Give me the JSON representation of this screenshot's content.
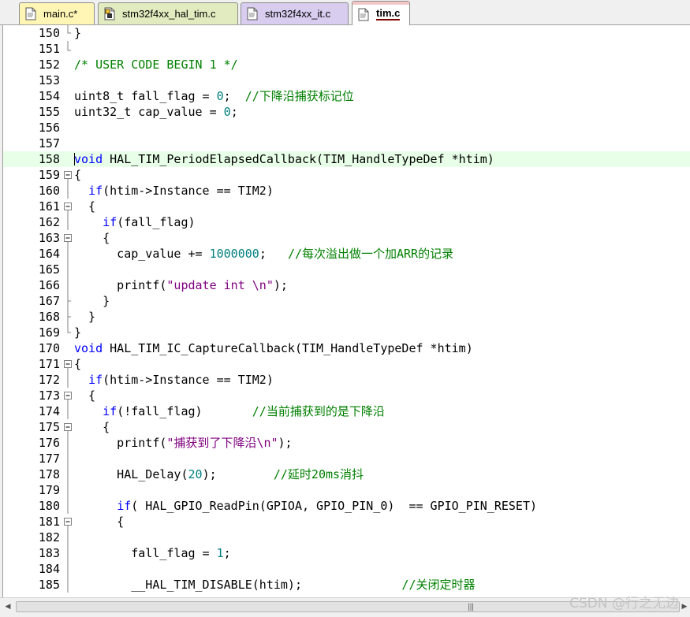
{
  "tabs": [
    {
      "label": "main.c*",
      "icon": "c-file-icon"
    },
    {
      "label": "stm32f4xx_hal_tim.c",
      "icon": "locked-file-icon"
    },
    {
      "label": "stm32f4xx_it.c",
      "icon": "c-file-icon"
    },
    {
      "label": "tim.c",
      "icon": "c-file-icon",
      "active": true
    }
  ],
  "colors": {
    "keyword": "#0000ff",
    "comment": "#008000",
    "number": "#008080",
    "string": "#800080",
    "current_line": "#e8ffe8"
  },
  "lines": [
    {
      "n": "150",
      "fold": "end",
      "tokens": [
        [
          "p",
          "}"
        ]
      ]
    },
    {
      "n": "151",
      "fold": "corner",
      "tokens": []
    },
    {
      "n": "152",
      "fold": "",
      "tokens": [
        [
          "c",
          "/* USER CODE BEGIN 1 */"
        ]
      ]
    },
    {
      "n": "153",
      "fold": "",
      "tokens": []
    },
    {
      "n": "154",
      "fold": "",
      "tokens": [
        [
          "p",
          "uint8_t fall_flag = "
        ],
        [
          "n",
          "0"
        ],
        [
          "p",
          ";  "
        ],
        [
          "c",
          "//下降沿捕获标记位"
        ]
      ]
    },
    {
      "n": "155",
      "fold": "",
      "tokens": [
        [
          "p",
          "uint32_t cap_value = "
        ],
        [
          "n",
          "0"
        ],
        [
          "p",
          ";"
        ]
      ]
    },
    {
      "n": "156",
      "fold": "",
      "tokens": []
    },
    {
      "n": "157",
      "fold": "",
      "tokens": []
    },
    {
      "n": "158",
      "fold": "",
      "hl": true,
      "tokens": [
        [
          "k",
          "void"
        ],
        [
          "p",
          " HAL_TIM_PeriodElapsedCallback(TIM_HandleTypeDef *htim)"
        ]
      ]
    },
    {
      "n": "159",
      "fold": "box",
      "tokens": [
        [
          "p",
          "{"
        ]
      ]
    },
    {
      "n": "160",
      "fold": "line",
      "tokens": [
        [
          "p",
          "  "
        ],
        [
          "k",
          "if"
        ],
        [
          "p",
          "(htim->Instance == TIM2)"
        ]
      ]
    },
    {
      "n": "161",
      "fold": "box",
      "tokens": [
        [
          "p",
          "  {"
        ]
      ]
    },
    {
      "n": "162",
      "fold": "line",
      "tokens": [
        [
          "p",
          "    "
        ],
        [
          "k",
          "if"
        ],
        [
          "p",
          "(fall_flag)"
        ]
      ]
    },
    {
      "n": "163",
      "fold": "box",
      "tokens": [
        [
          "p",
          "    {"
        ]
      ]
    },
    {
      "n": "164",
      "fold": "line",
      "tokens": [
        [
          "p",
          "      cap_value += "
        ],
        [
          "n",
          "1000000"
        ],
        [
          "p",
          ";   "
        ],
        [
          "c",
          "//每次溢出做一个加ARR的记录"
        ]
      ]
    },
    {
      "n": "165",
      "fold": "line",
      "tokens": []
    },
    {
      "n": "166",
      "fold": "line",
      "tokens": [
        [
          "p",
          "      printf("
        ],
        [
          "s",
          "\"update int \\n\""
        ],
        [
          "p",
          ");"
        ]
      ]
    },
    {
      "n": "167",
      "fold": "tick",
      "tokens": [
        [
          "p",
          "    }"
        ]
      ]
    },
    {
      "n": "168",
      "fold": "tick",
      "tokens": [
        [
          "p",
          "  }"
        ]
      ]
    },
    {
      "n": "169",
      "fold": "end",
      "tokens": [
        [
          "p",
          "}"
        ]
      ]
    },
    {
      "n": "170",
      "fold": "",
      "tokens": [
        [
          "k",
          "void"
        ],
        [
          "p",
          " HAL_TIM_IC_CaptureCallback(TIM_HandleTypeDef *htim)"
        ]
      ]
    },
    {
      "n": "171",
      "fold": "box",
      "tokens": [
        [
          "p",
          "{"
        ]
      ]
    },
    {
      "n": "172",
      "fold": "line",
      "tokens": [
        [
          "p",
          "  "
        ],
        [
          "k",
          "if"
        ],
        [
          "p",
          "(htim->Instance == TIM2)"
        ]
      ]
    },
    {
      "n": "173",
      "fold": "box",
      "tokens": [
        [
          "p",
          "  {"
        ]
      ]
    },
    {
      "n": "174",
      "fold": "line",
      "tokens": [
        [
          "p",
          "    "
        ],
        [
          "k",
          "if"
        ],
        [
          "p",
          "(!fall_flag)       "
        ],
        [
          "c",
          "//当前捕获到的是下降沿"
        ]
      ]
    },
    {
      "n": "175",
      "fold": "box",
      "tokens": [
        [
          "p",
          "    {"
        ]
      ]
    },
    {
      "n": "176",
      "fold": "line",
      "tokens": [
        [
          "p",
          "      printf("
        ],
        [
          "s",
          "\"捕获到了下降沿\\n\""
        ],
        [
          "p",
          ");"
        ]
      ]
    },
    {
      "n": "177",
      "fold": "line",
      "tokens": []
    },
    {
      "n": "178",
      "fold": "line",
      "tokens": [
        [
          "p",
          "      HAL_Delay("
        ],
        [
          "n",
          "20"
        ],
        [
          "p",
          ");        "
        ],
        [
          "c",
          "//延时20ms消抖"
        ]
      ]
    },
    {
      "n": "179",
      "fold": "line",
      "tokens": []
    },
    {
      "n": "180",
      "fold": "line",
      "tokens": [
        [
          "p",
          "      "
        ],
        [
          "k",
          "if"
        ],
        [
          "p",
          "( HAL_GPIO_ReadPin(GPIOA, GPIO_PIN_0)  == GPIO_PIN_RESET)"
        ]
      ]
    },
    {
      "n": "181",
      "fold": "box",
      "tokens": [
        [
          "p",
          "      {"
        ]
      ]
    },
    {
      "n": "182",
      "fold": "line",
      "tokens": []
    },
    {
      "n": "183",
      "fold": "line",
      "tokens": [
        [
          "p",
          "        fall_flag = "
        ],
        [
          "n",
          "1"
        ],
        [
          "p",
          ";"
        ]
      ]
    },
    {
      "n": "184",
      "fold": "line",
      "tokens": []
    },
    {
      "n": "185",
      "fold": "line",
      "tokens": [
        [
          "p",
          "        __HAL_TIM_DISABLE(htim);              "
        ],
        [
          "c",
          "//关闭定时器"
        ]
      ]
    }
  ],
  "scrollbar": {
    "left_arrow": "◀",
    "right_arrow": "▶",
    "grip": "|||"
  },
  "watermark": "CSDN @行之无边"
}
